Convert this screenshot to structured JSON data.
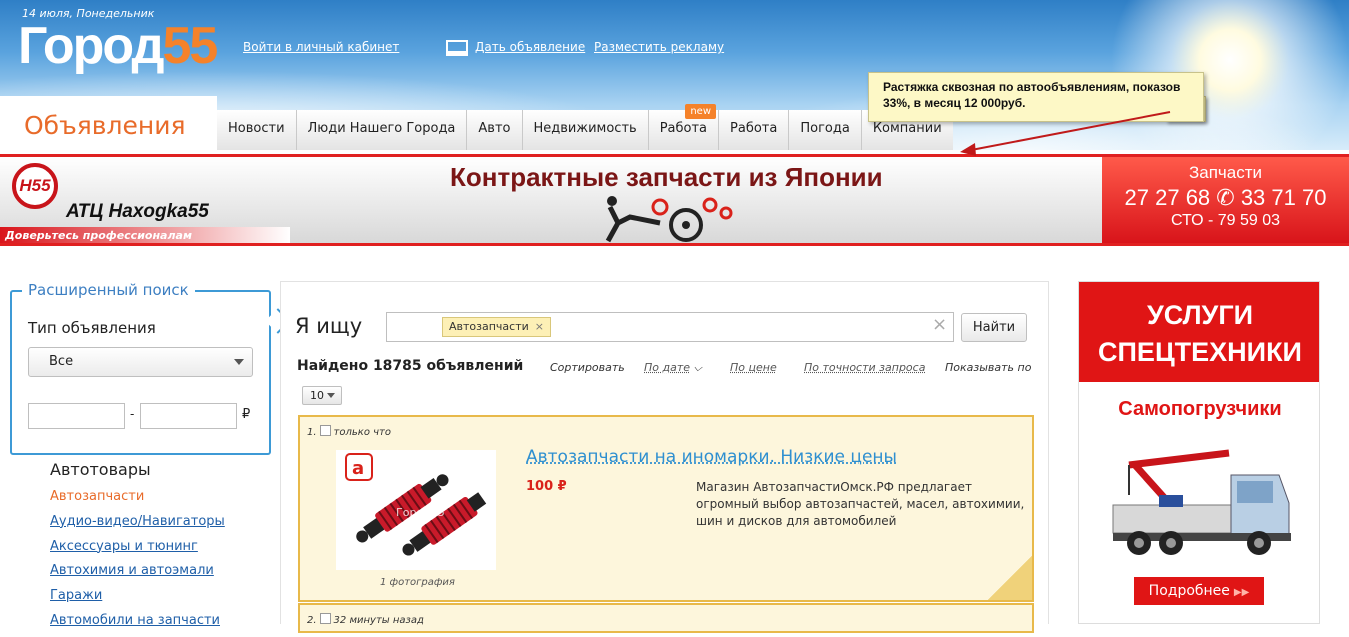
{
  "header": {
    "date": "14 июля, Понедельник",
    "logo_text": "Город",
    "logo_num": "55",
    "login_link": "Войти в личный кабинет",
    "post_ad_link": "Дать объявление",
    "advertise_link": "Разместить рекламу",
    "promo_note": "Растяжка сквозная по автообъявлениям, показов 33%, в месяц 12 000руб."
  },
  "nav": {
    "section": "Объявления",
    "items": [
      {
        "label": "Новости"
      },
      {
        "label": "Люди Нашего Города"
      },
      {
        "label": "Авто"
      },
      {
        "label": "Недвижимость"
      },
      {
        "label": "Работа",
        "badge": "new"
      },
      {
        "label": "Работа"
      },
      {
        "label": "Погода"
      },
      {
        "label": "Компании"
      }
    ]
  },
  "banner": {
    "logo_text": "Н55",
    "brand": "АТЦ Haxogka55",
    "slogan": "Доверьтесь профессионалам",
    "title": "Контрактные запчасти из Японии",
    "phone_label": "Запчасти",
    "phone_numbers": "27 27 68 ✆ 33 71 70",
    "sto": "СТО - 79 59 03"
  },
  "search": {
    "title": "Расширенный поиск",
    "type_label": "Тип объявления",
    "type_value": "Все",
    "price_dash": "-",
    "currency": "₽"
  },
  "categories": {
    "title": "Автотовары",
    "items": [
      {
        "label": "Автозапчасти"
      },
      {
        "label": "Аудио-видео/Навигаторы"
      },
      {
        "label": "Аксессуары и тюнинг"
      },
      {
        "label": "Автохимия и автоэмали"
      },
      {
        "label": "Гаражи"
      },
      {
        "label": "Автомобили на запчасти"
      }
    ]
  },
  "main": {
    "i_seek": "Я ищу",
    "tag": "Автозапчасти",
    "tag_remove": "×",
    "clear": "×",
    "find_button": "Найти",
    "found": "Найдено 18785 объявлений",
    "sort_label": "Сортировать",
    "sort_date": "По дате",
    "sort_price": "По цене",
    "sort_relevance": "По точности запроса",
    "show_label": "Показывать по",
    "per_page": "10"
  },
  "listings": [
    {
      "index": "1.",
      "time": "только что",
      "title": "Автозапчасти на иномарки. Низкие цены",
      "price": "100 ₽",
      "description": "Магазин АвтозапчастиОмск.РФ предлагает огромный выбор автозапчастей, масел, автохимии, шин и дисков для автомобилей",
      "photo_caption": "1 фотография",
      "photo_watermark": "Город55"
    },
    {
      "index": "2.",
      "time": "32 минуты назад"
    }
  ],
  "right_ad": {
    "headline": "УСЛУГИ СПЕЦТЕХНИКИ",
    "subheadline": "Самопогрузчики",
    "button": "Подробнее",
    "button_arrows": "▶▶"
  },
  "colors": {
    "accent_orange": "#e86b2a",
    "link_blue": "#1f5fa8",
    "banner_red": "#e02020",
    "highlight_bg": "#fdf6dc"
  }
}
